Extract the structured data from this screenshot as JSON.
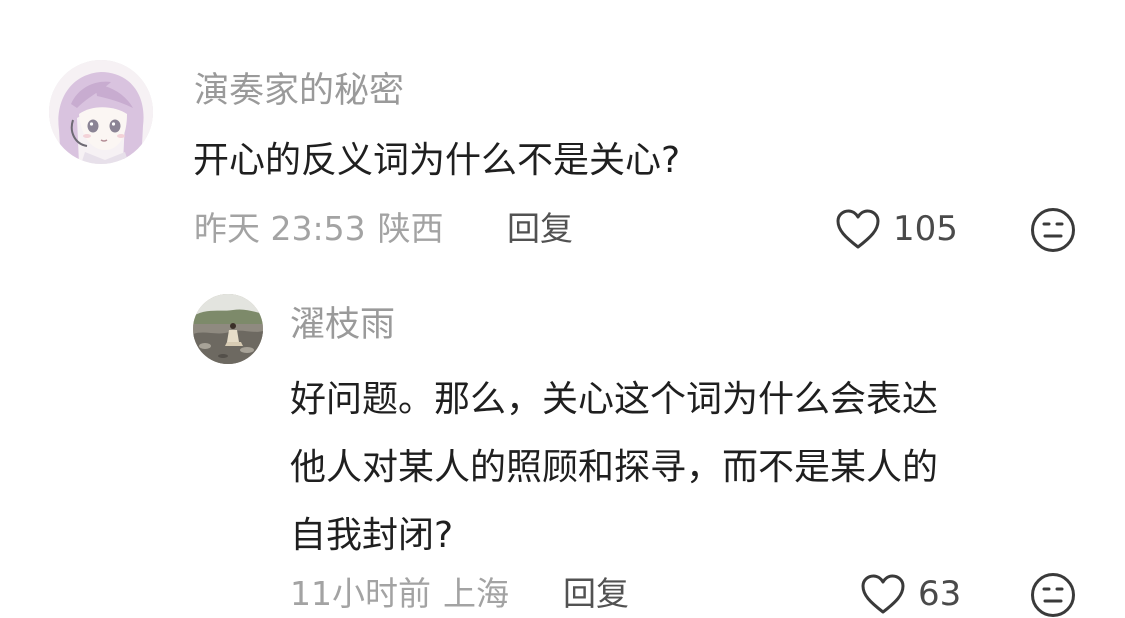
{
  "comment": {
    "username": "演奏家的秘密",
    "text": "开心的反义词为什么不是关心?",
    "time": "昨天 23:53",
    "location": "陕西",
    "reply_label": "回复",
    "likes": "105",
    "avatar_icon": "anime-girl-avatar",
    "dislike_icon": "dislike-face-icon"
  },
  "reply": {
    "username": "濯枝雨",
    "text_lines": [
      "好问题。那么，关心这个词为什么会表达",
      "他人对某人的照顾和探寻，而不是某人的",
      "自我封闭?"
    ],
    "time": "11小时前",
    "location": "上海",
    "reply_label": "回复",
    "likes": "63",
    "avatar_icon": "photo-avatar",
    "dislike_icon": "dislike-face-icon"
  },
  "colors": {
    "text_primary": "#1f1f1f",
    "text_secondary": "#9a9a9a",
    "icon": "#3a3a3a"
  }
}
